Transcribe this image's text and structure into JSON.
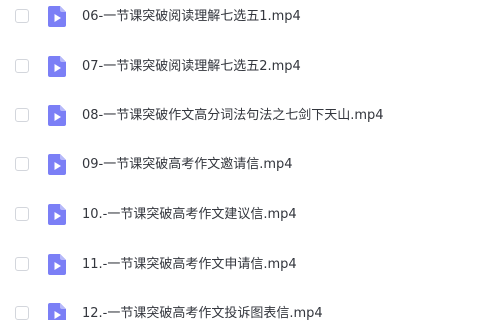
{
  "accent_color": "#7b7ff6",
  "file_icon": "video-file-icon",
  "files": [
    {
      "name": "06-一节课突破阅读理解七选五1.mp4"
    },
    {
      "name": "07-一节课突破阅读理解七选五2.mp4"
    },
    {
      "name": "08-一节课突破作文高分词法句法之七剑下天山.mp4"
    },
    {
      "name": "09-一节课突破高考作文邀请信.mp4"
    },
    {
      "name": "10.-一节课突破高考作文建议信.mp4"
    },
    {
      "name": "11.-一节课突破高考作文申请信.mp4"
    },
    {
      "name": "12.-一节课突破高考作文投诉图表信.mp4"
    }
  ]
}
